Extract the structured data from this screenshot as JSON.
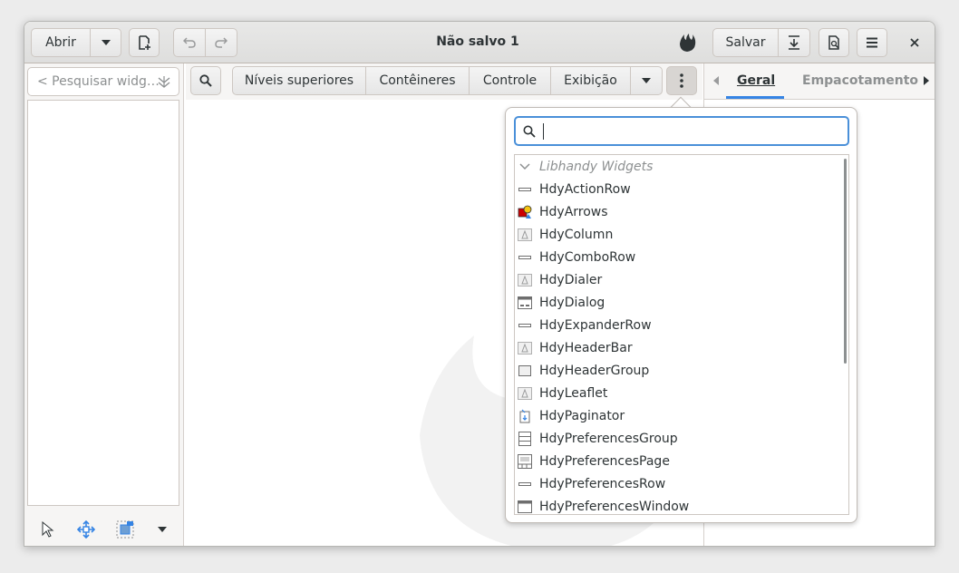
{
  "header": {
    "open_label": "Abrir",
    "title": "Não salvo 1",
    "save_label": "Salvar"
  },
  "sidebar": {
    "search_placeholder": "< Pesquisar widg…"
  },
  "palette": {
    "tabs": [
      "Níveis superiores",
      "Contêineres",
      "Controle",
      "Exibição"
    ]
  },
  "properties": {
    "tabs": [
      "Geral",
      "Empacotamento"
    ],
    "active_tab": "Geral"
  },
  "popover": {
    "search_value": "",
    "group": "Libhandy Widgets",
    "items": [
      {
        "label": "HdyActionRow",
        "icon": "row-icon"
      },
      {
        "label": "HdyArrows",
        "icon": "arrows-icon"
      },
      {
        "label": "HdyColumn",
        "icon": "generic-widget-icon"
      },
      {
        "label": "HdyComboRow",
        "icon": "row-icon"
      },
      {
        "label": "HdyDialer",
        "icon": "generic-widget-icon"
      },
      {
        "label": "HdyDialog",
        "icon": "dialog-icon"
      },
      {
        "label": "HdyExpanderRow",
        "icon": "row-icon"
      },
      {
        "label": "HdyHeaderBar",
        "icon": "generic-widget-icon"
      },
      {
        "label": "HdyHeaderGroup",
        "icon": "box-icon"
      },
      {
        "label": "HdyLeaflet",
        "icon": "generic-widget-icon"
      },
      {
        "label": "HdyPaginator",
        "icon": "paginator-icon"
      },
      {
        "label": "HdyPreferencesGroup",
        "icon": "group-icon"
      },
      {
        "label": "HdyPreferencesPage",
        "icon": "page-icon"
      },
      {
        "label": "HdyPreferencesRow",
        "icon": "row-icon"
      },
      {
        "label": "HdyPreferencesWindow",
        "icon": "window-icon"
      }
    ]
  },
  "colors": {
    "accent": "#4a90d9",
    "selected_tab_underline": "#3584e4"
  }
}
